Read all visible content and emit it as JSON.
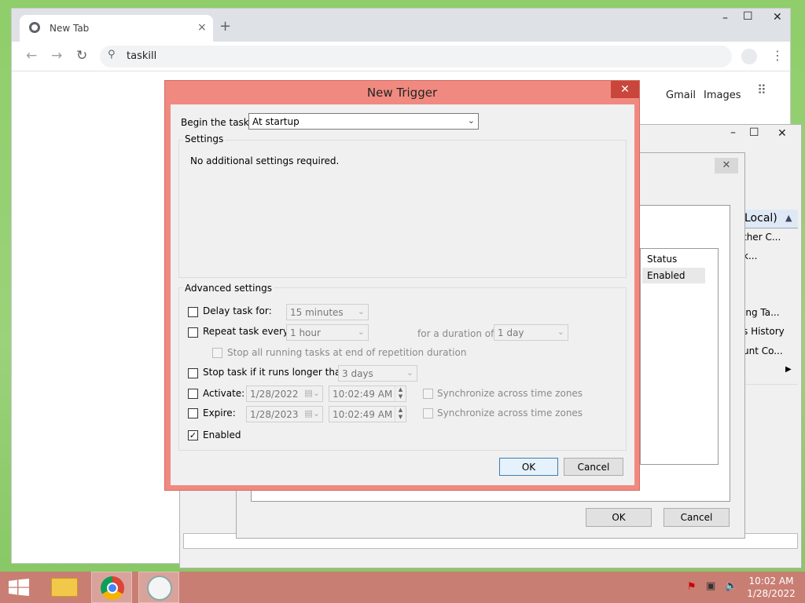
{
  "browser": {
    "tab_title": "New Tab",
    "tab_close": "×",
    "new_tab": "+",
    "minimize": "–",
    "maximize": "☐",
    "close": "✕",
    "address_value": "taskill",
    "links": {
      "gmail": "Gmail",
      "images": "Images"
    }
  },
  "background": {
    "status_header": "Status",
    "status_value": "Enabled",
    "actions_title": "Local)",
    "actions_items": [
      "ther C...",
      "k...",
      "ing Ta...",
      "s History",
      "unt Co..."
    ],
    "ok_label": "OK",
    "cancel_label": "Cancel"
  },
  "dialog": {
    "title": "New Trigger",
    "close": "✕",
    "begin_label": "Begin the task:",
    "begin_value": "At startup",
    "settings_title": "Settings",
    "settings_message": "No additional settings required.",
    "advanced_title": "Advanced settings",
    "delay_label": "Delay task for:",
    "delay_value": "15 minutes",
    "repeat_label": "Repeat task every:",
    "repeat_value": "1 hour",
    "duration_label": "for a duration of:",
    "duration_value": "1 day",
    "stop_running_label": "Stop all running tasks at end of repetition duration",
    "stop_longer_label": "Stop task if it runs longer than:",
    "stop_longer_value": "3 days",
    "activate_label": "Activate:",
    "activate_date": "1/28/2022",
    "activate_time": "10:02:49 AM",
    "expire_label": "Expire:",
    "expire_date": "1/28/2023",
    "expire_time": "10:02:49 AM",
    "sync_label": "Synchronize across time zones",
    "enabled_label": "Enabled",
    "enabled_checked": "✓",
    "ok_label": "OK",
    "cancel_label": "Cancel"
  },
  "taskbar": {
    "time": "10:02 AM",
    "date": "1/28/2022"
  }
}
